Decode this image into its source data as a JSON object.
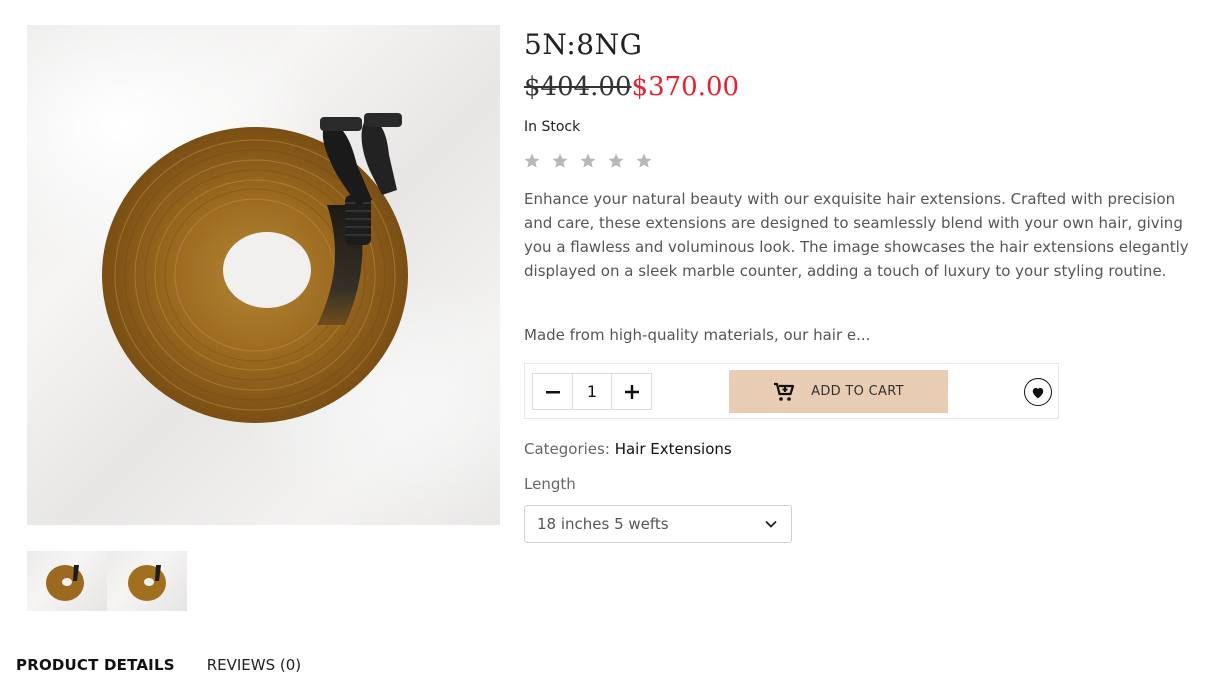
{
  "product": {
    "title": "5N:8NG",
    "old_price": "$404.00",
    "new_price": "$370.00",
    "stock_status": "In Stock",
    "rating": 0,
    "rating_max": 5,
    "description": "Enhance your natural beauty with our exquisite hair extensions. Crafted with precision and care, these extensions are designed to seamlessly blend with your own hair, giving you a flawless and voluminous look. The image showcases the hair extensions elegantly displayed on a sleek marble counter, adding a touch of luxury to your styling routine.",
    "excerpt": "Made from high-quality materials, our hair e..."
  },
  "cart": {
    "minus_icon": "minus",
    "quantity": "1",
    "plus_icon": "plus",
    "add_to_cart_label": "ADD TO CART",
    "cart_icon": "cart-plus-icon",
    "wishlist_icon": "heart-icon"
  },
  "meta": {
    "categories_label": "Categories:",
    "category": "Hair Extensions",
    "length_label": "Length",
    "length_selected": "18 inches 5 wefts"
  },
  "tabs": [
    {
      "label": "PRODUCT DETAILS",
      "active": true
    },
    {
      "label": "REVIEWS (0)",
      "active": false
    }
  ],
  "colors": {
    "sale_price": "#e8202d",
    "add_to_cart_bg": "#e8cdb4",
    "star_empty": "#b8b8b8",
    "hair_brown": "#9a6a22",
    "hair_root": "#1e1e1e"
  }
}
